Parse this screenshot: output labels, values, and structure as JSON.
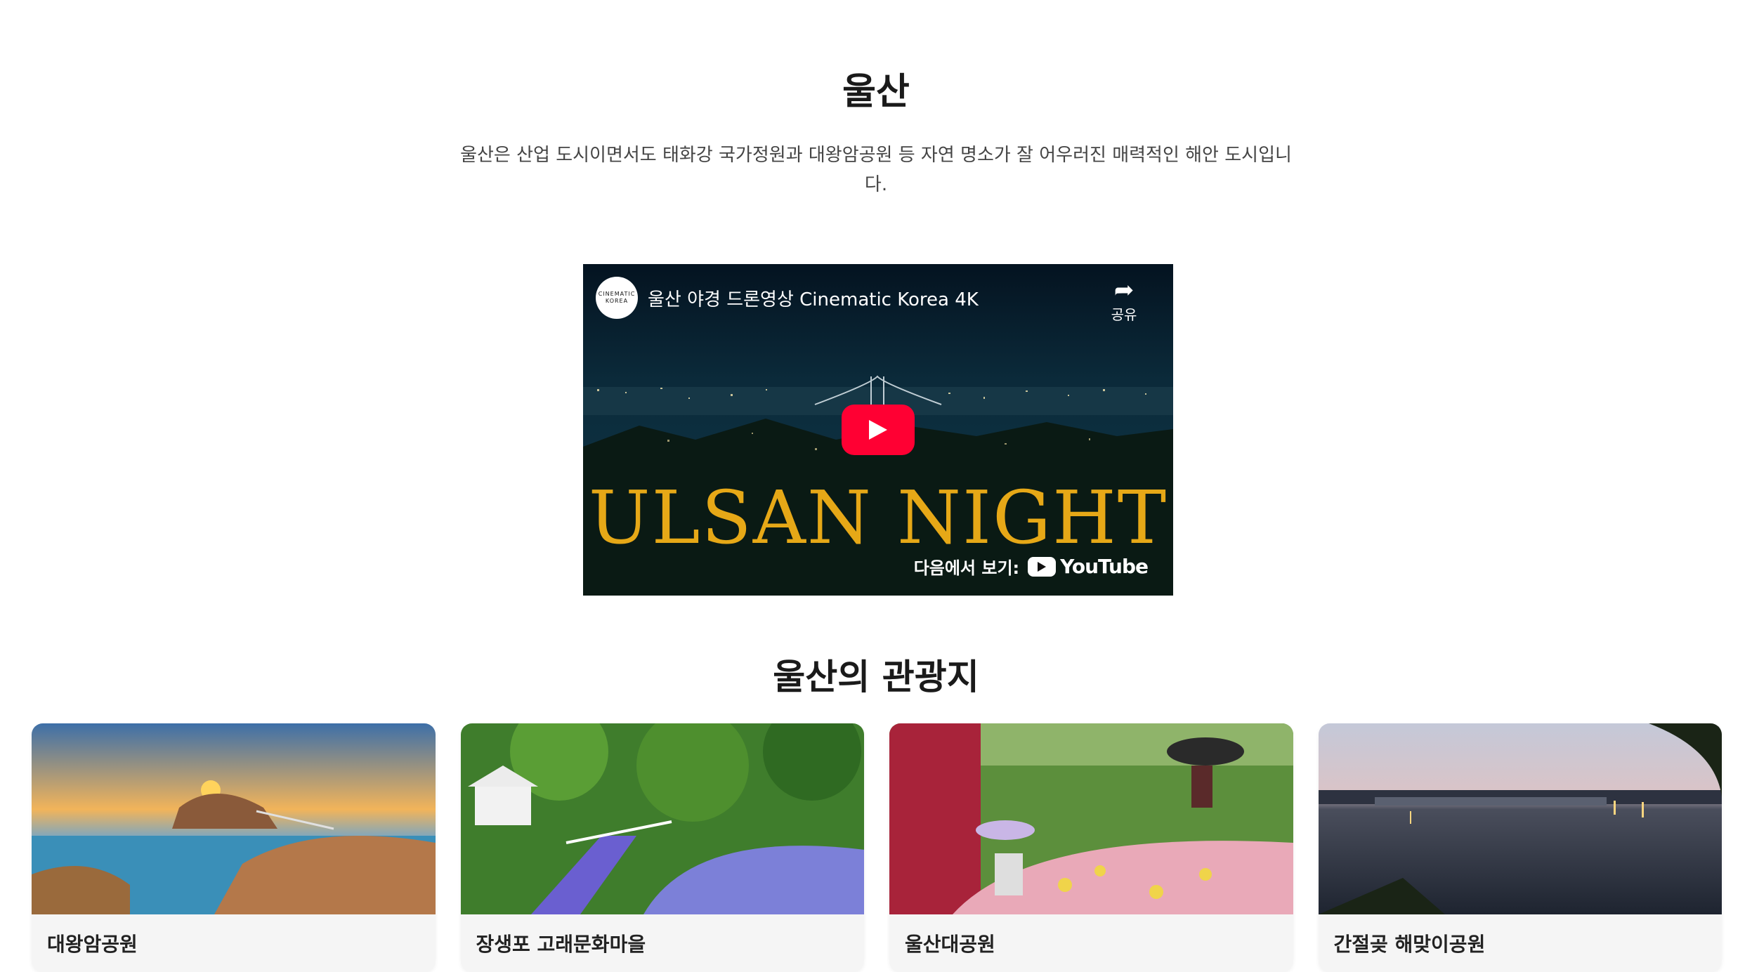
{
  "page": {
    "title": "울산",
    "description": "울산은 산업 도시이면서도 태화강 국가정원과 대왕암공원 등 자연 명소가 잘 어우러진 매력적인 해안 도시입니다."
  },
  "video": {
    "channel_logo_text_top": "CINEMATIC",
    "channel_logo_text_bottom": "KOREA",
    "title": "울산 야경 드론영상 Cinematic Korea 4K",
    "share_label": "공유",
    "overlay_text": "ULSAN NIGHT",
    "watch_on_label": "다음에서 보기:",
    "youtube_label": "YouTube",
    "play_color": "#ff0033",
    "overlay_color": "#e6a817",
    "icons": [
      "share-icon",
      "play-icon",
      "youtube-logo-icon"
    ]
  },
  "attractions": {
    "heading": "울산의 관광지",
    "items": [
      {
        "name": "대왕암공원"
      },
      {
        "name": "장생포 고래문화마을"
      },
      {
        "name": "울산대공원"
      },
      {
        "name": "간절곶 해맞이공원"
      }
    ]
  }
}
